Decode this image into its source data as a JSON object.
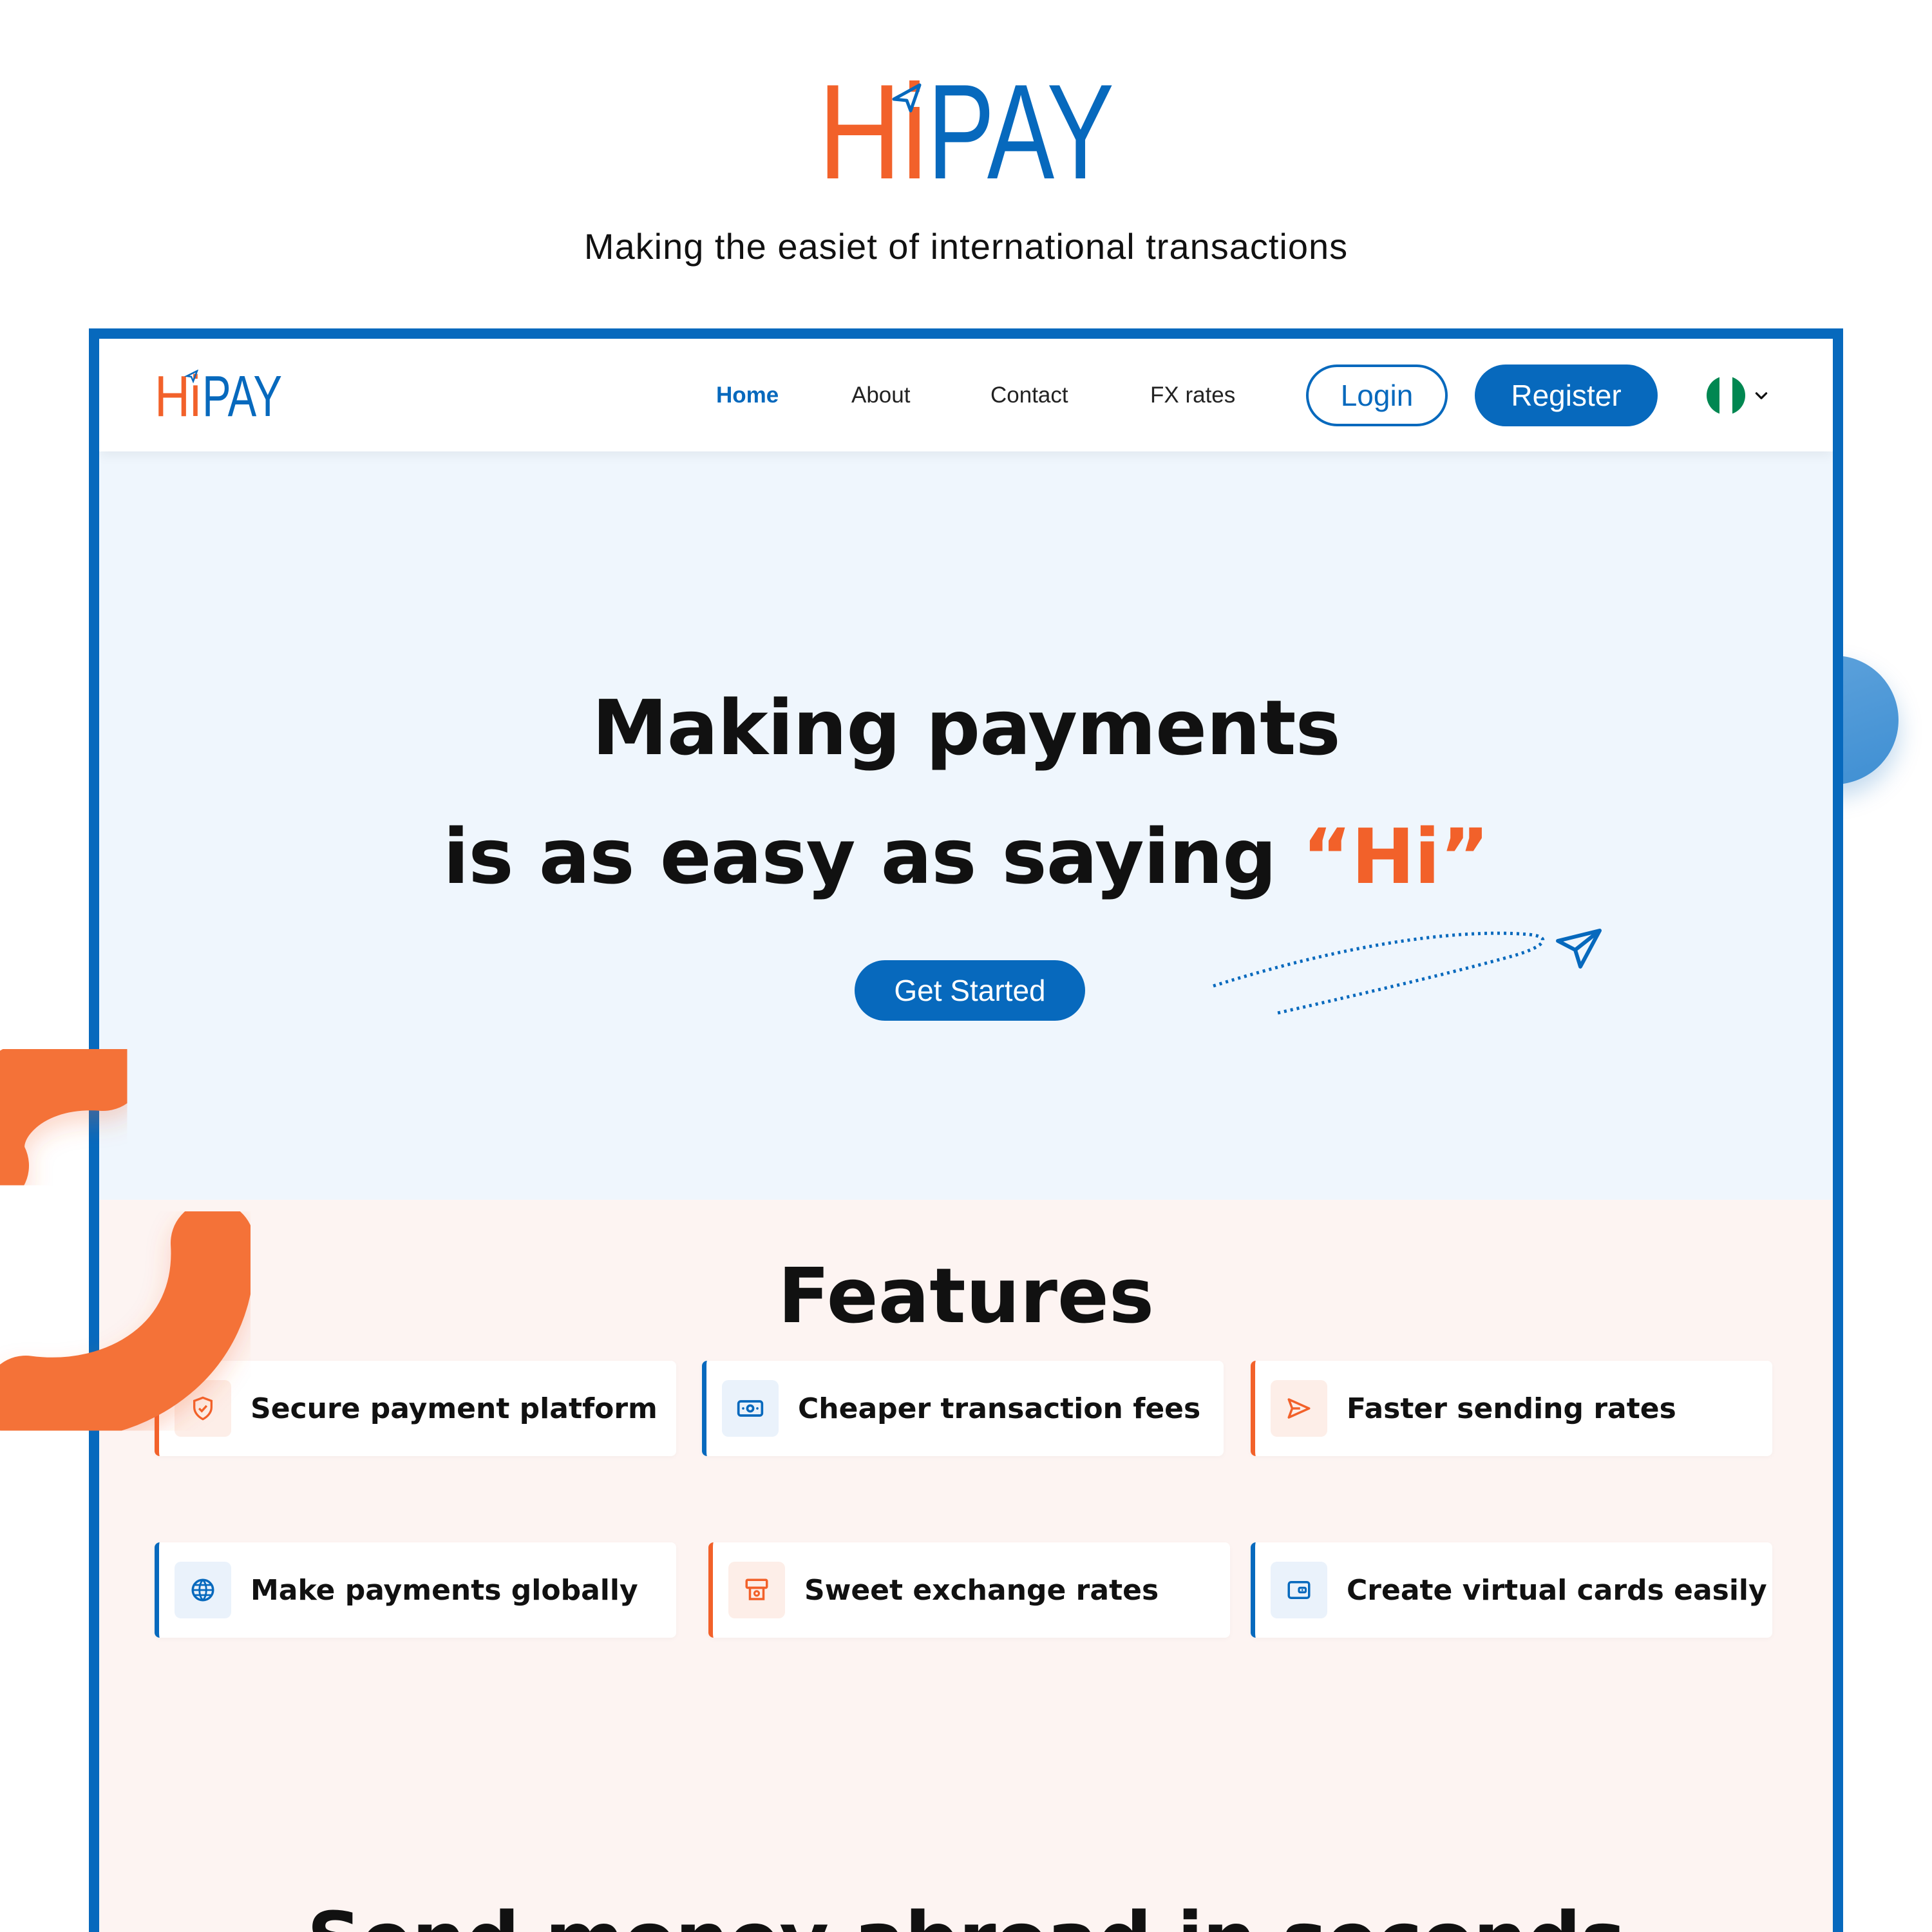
{
  "showcase": {
    "brand": {
      "part1": "Hi",
      "part2": "PAY"
    },
    "tagline": "Making the easiet of international transactions"
  },
  "nav": {
    "brand": {
      "part1": "Hi",
      "part2": "PAY"
    },
    "links": [
      {
        "label": "Home",
        "active": true
      },
      {
        "label": "About",
        "active": false
      },
      {
        "label": "Contact",
        "active": false
      },
      {
        "label": "FX rates",
        "active": false
      }
    ],
    "login_label": "Login",
    "register_label": "Register",
    "language": {
      "flag": "nigeria-flag-icon",
      "colors": [
        "#008751",
        "#ffffff",
        "#008751"
      ]
    }
  },
  "hero": {
    "line1": "Making payments",
    "line2_prefix": "is as easy as saying ",
    "line2_accent": "“Hi”",
    "cta_label": "Get Started"
  },
  "features": {
    "title": "Features",
    "items": [
      {
        "label": "Secure payment platform",
        "icon": "shield-icon",
        "accent": "orange"
      },
      {
        "label": "Cheaper transaction fees",
        "icon": "cash-icon",
        "accent": "blue"
      },
      {
        "label": "Faster sending rates",
        "icon": "send-icon",
        "accent": "orange"
      },
      {
        "label": "Make payments globally",
        "icon": "globe-icon",
        "accent": "blue"
      },
      {
        "label": "Sweet exchange rates",
        "icon": "atm-icon",
        "accent": "orange"
      },
      {
        "label": "Create virtual cards easily",
        "icon": "card-icon",
        "accent": "blue"
      }
    ]
  },
  "send_section": {
    "title": "Send money abroad in seconds"
  },
  "colors": {
    "brand_blue": "#0769bd",
    "brand_orange": "#f2612a",
    "hero_bg": "#eff6fd",
    "features_bg": "#fdf4f2"
  }
}
